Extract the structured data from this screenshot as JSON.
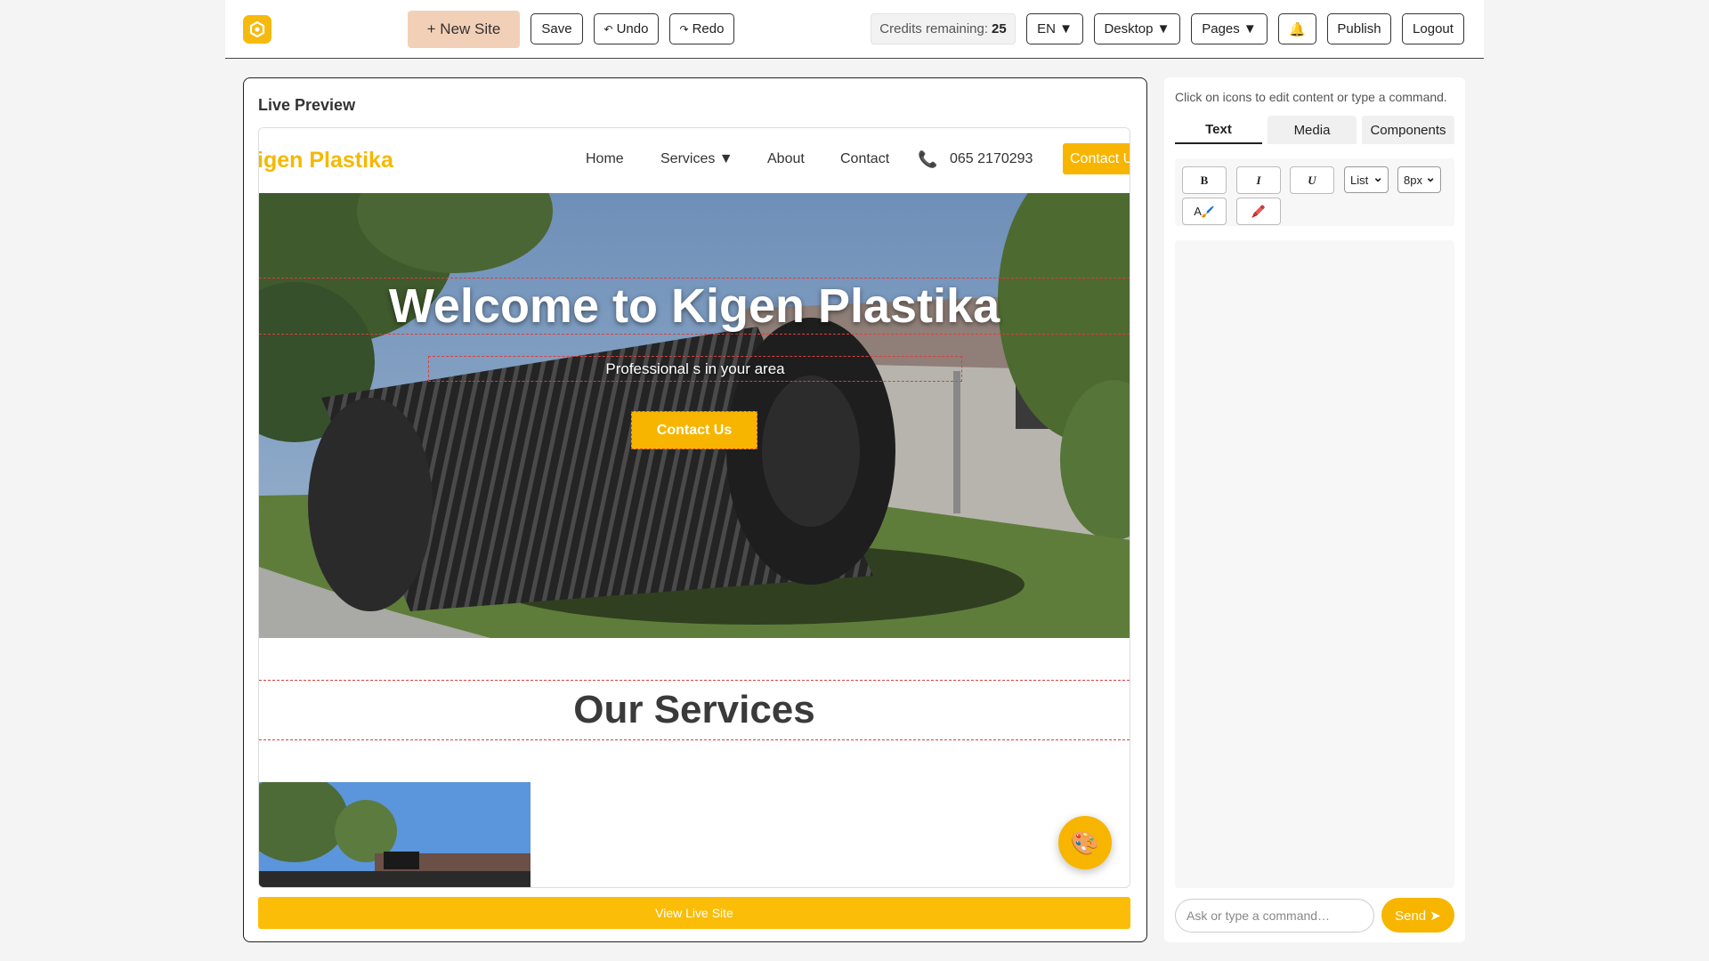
{
  "topbar": {
    "logo_icon": "hexagon-logo-icon",
    "new_site_label": "+ New Site",
    "save_label": "Save",
    "undo_label": "Undo",
    "redo_label": "Redo",
    "credits_label": "Credits remaining:",
    "credits_value": "25",
    "language_label": "EN ▼",
    "device_label": "Desktop ▼",
    "pages_label": "Pages ▼",
    "notification_icon": "🔔",
    "publish_label": "Publish",
    "logout_label": "Logout",
    "accent_color": "#f6b90e"
  },
  "preview": {
    "title": "Live Preview",
    "site": {
      "brand": "igen Plastika",
      "nav": [
        "Home",
        "Services ▼",
        "About",
        "Contact"
      ],
      "phone_icon": "📞",
      "phone": "065 2170293",
      "nav_cta": "Contact Us",
      "hero_title": "Welcome to Kigen Plastika",
      "hero_subtitle": "Professional s in your area",
      "hero_button": "Contact Us",
      "services_title": "Our Services"
    },
    "palette_icon": "🎨",
    "view_live_label": "View Live Site"
  },
  "side": {
    "hint": "Click on icons to edit content or type a command.",
    "tabs": [
      "Text",
      "Media",
      "Components"
    ],
    "format": {
      "bold": "B",
      "italic": "I",
      "underline": "U",
      "list_select": "List",
      "size_select": "8px",
      "text_color_label": "A",
      "text_color_icon": "🖌️",
      "highlight_icon": "🖍️"
    },
    "command_placeholder": "Ask or type a command…",
    "send_label": "Send ➤"
  }
}
